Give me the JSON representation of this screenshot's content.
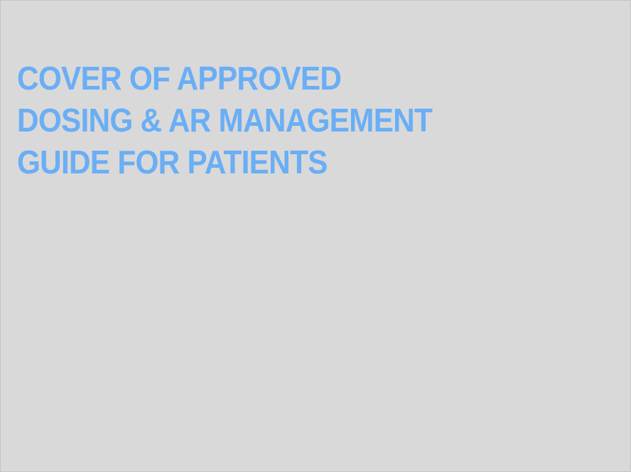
{
  "placeholder": {
    "title_lines": [
      "COVER OF APPROVED",
      "DOSING & AR MANAGEMENT",
      "GUIDE FOR PATIENTS"
    ],
    "colors": {
      "background": "#d9d9d9",
      "title": "#6aaef5"
    }
  }
}
